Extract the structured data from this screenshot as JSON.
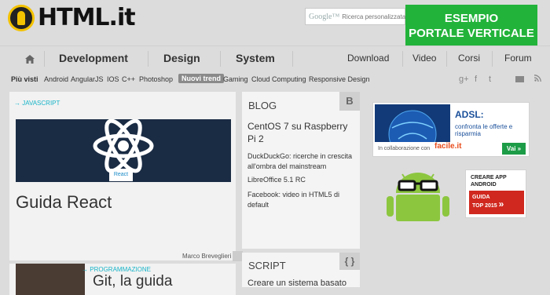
{
  "logo": {
    "text": "HTML.it"
  },
  "search": {
    "brand": "Google™",
    "placeholder": "Ricerca personalizzata"
  },
  "promo": {
    "line1": "ESEMPIO",
    "line2": "PORTALE VERTICALE"
  },
  "nav": {
    "left": [
      "Development",
      "Design",
      "System"
    ],
    "right": [
      "Download",
      "Video",
      "Corsi",
      "Forum"
    ]
  },
  "tags": {
    "most_viewed_label": "Più visti",
    "most_viewed": [
      "Android",
      "AngularJS",
      "IOS",
      "C++",
      "Photoshop"
    ],
    "trend_label": "Nuovi trend",
    "trend": [
      "Gaming",
      "Cloud Computing",
      "Responsive Design"
    ]
  },
  "social": [
    "g+",
    "f",
    "t"
  ],
  "feature": {
    "category": "JAVASCRIPT",
    "tag": "React",
    "title": "Guida React",
    "author": "Marco Breveglieri"
  },
  "feature2": {
    "category": "PROGRAMMAZIONE",
    "title": "Git, la guida"
  },
  "blog": {
    "heading": "BLOG",
    "corner": "B",
    "posts": [
      "CentOS 7 su Raspberry Pi 2",
      "DuckDuckGo: ricerche in crescita all'ombra del mainstream",
      "LibreOffice 5.1 RC",
      "Facebook: video in HTML5 di default"
    ]
  },
  "script": {
    "heading": "SCRIPT",
    "corner": "{ }",
    "post": "Creare un sistema basato"
  },
  "ad_adsl": {
    "title": "ADSL:",
    "subtitle": "confronta le offerte e risparmia",
    "collab": "In collaborazione con",
    "brand": "facile.it",
    "cta": "Vai »"
  },
  "ad_android": {
    "line1": "CREARE APP",
    "line2": "ANDROID",
    "badge1": "GUIDA",
    "badge2": "TOP 2015",
    "arrow": "»"
  }
}
